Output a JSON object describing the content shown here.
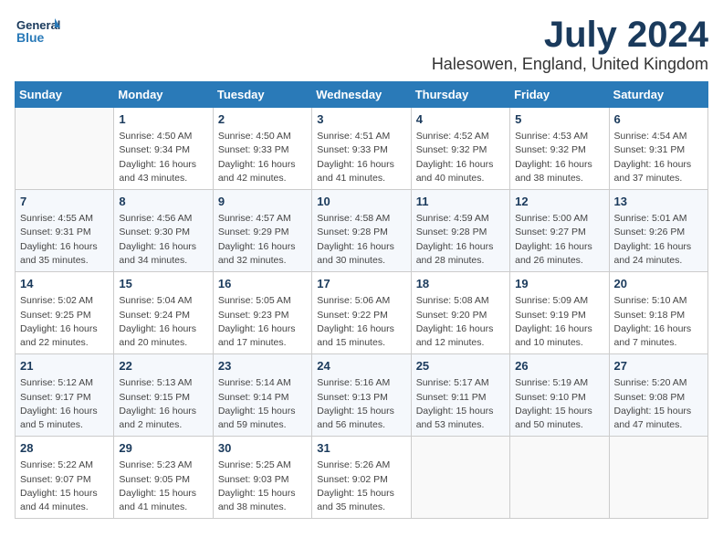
{
  "header": {
    "logo_line1": "General",
    "logo_line2": "Blue",
    "main_title": "July 2024",
    "subtitle": "Halesowen, England, United Kingdom"
  },
  "calendar": {
    "columns": [
      "Sunday",
      "Monday",
      "Tuesday",
      "Wednesday",
      "Thursday",
      "Friday",
      "Saturday"
    ],
    "weeks": [
      [
        {
          "day": "",
          "content": ""
        },
        {
          "day": "1",
          "content": "Sunrise: 4:50 AM\nSunset: 9:34 PM\nDaylight: 16 hours\nand 43 minutes."
        },
        {
          "day": "2",
          "content": "Sunrise: 4:50 AM\nSunset: 9:33 PM\nDaylight: 16 hours\nand 42 minutes."
        },
        {
          "day": "3",
          "content": "Sunrise: 4:51 AM\nSunset: 9:33 PM\nDaylight: 16 hours\nand 41 minutes."
        },
        {
          "day": "4",
          "content": "Sunrise: 4:52 AM\nSunset: 9:32 PM\nDaylight: 16 hours\nand 40 minutes."
        },
        {
          "day": "5",
          "content": "Sunrise: 4:53 AM\nSunset: 9:32 PM\nDaylight: 16 hours\nand 38 minutes."
        },
        {
          "day": "6",
          "content": "Sunrise: 4:54 AM\nSunset: 9:31 PM\nDaylight: 16 hours\nand 37 minutes."
        }
      ],
      [
        {
          "day": "7",
          "content": "Sunrise: 4:55 AM\nSunset: 9:31 PM\nDaylight: 16 hours\nand 35 minutes."
        },
        {
          "day": "8",
          "content": "Sunrise: 4:56 AM\nSunset: 9:30 PM\nDaylight: 16 hours\nand 34 minutes."
        },
        {
          "day": "9",
          "content": "Sunrise: 4:57 AM\nSunset: 9:29 PM\nDaylight: 16 hours\nand 32 minutes."
        },
        {
          "day": "10",
          "content": "Sunrise: 4:58 AM\nSunset: 9:28 PM\nDaylight: 16 hours\nand 30 minutes."
        },
        {
          "day": "11",
          "content": "Sunrise: 4:59 AM\nSunset: 9:28 PM\nDaylight: 16 hours\nand 28 minutes."
        },
        {
          "day": "12",
          "content": "Sunrise: 5:00 AM\nSunset: 9:27 PM\nDaylight: 16 hours\nand 26 minutes."
        },
        {
          "day": "13",
          "content": "Sunrise: 5:01 AM\nSunset: 9:26 PM\nDaylight: 16 hours\nand 24 minutes."
        }
      ],
      [
        {
          "day": "14",
          "content": "Sunrise: 5:02 AM\nSunset: 9:25 PM\nDaylight: 16 hours\nand 22 minutes."
        },
        {
          "day": "15",
          "content": "Sunrise: 5:04 AM\nSunset: 9:24 PM\nDaylight: 16 hours\nand 20 minutes."
        },
        {
          "day": "16",
          "content": "Sunrise: 5:05 AM\nSunset: 9:23 PM\nDaylight: 16 hours\nand 17 minutes."
        },
        {
          "day": "17",
          "content": "Sunrise: 5:06 AM\nSunset: 9:22 PM\nDaylight: 16 hours\nand 15 minutes."
        },
        {
          "day": "18",
          "content": "Sunrise: 5:08 AM\nSunset: 9:20 PM\nDaylight: 16 hours\nand 12 minutes."
        },
        {
          "day": "19",
          "content": "Sunrise: 5:09 AM\nSunset: 9:19 PM\nDaylight: 16 hours\nand 10 minutes."
        },
        {
          "day": "20",
          "content": "Sunrise: 5:10 AM\nSunset: 9:18 PM\nDaylight: 16 hours\nand 7 minutes."
        }
      ],
      [
        {
          "day": "21",
          "content": "Sunrise: 5:12 AM\nSunset: 9:17 PM\nDaylight: 16 hours\nand 5 minutes."
        },
        {
          "day": "22",
          "content": "Sunrise: 5:13 AM\nSunset: 9:15 PM\nDaylight: 16 hours\nand 2 minutes."
        },
        {
          "day": "23",
          "content": "Sunrise: 5:14 AM\nSunset: 9:14 PM\nDaylight: 15 hours\nand 59 minutes."
        },
        {
          "day": "24",
          "content": "Sunrise: 5:16 AM\nSunset: 9:13 PM\nDaylight: 15 hours\nand 56 minutes."
        },
        {
          "day": "25",
          "content": "Sunrise: 5:17 AM\nSunset: 9:11 PM\nDaylight: 15 hours\nand 53 minutes."
        },
        {
          "day": "26",
          "content": "Sunrise: 5:19 AM\nSunset: 9:10 PM\nDaylight: 15 hours\nand 50 minutes."
        },
        {
          "day": "27",
          "content": "Sunrise: 5:20 AM\nSunset: 9:08 PM\nDaylight: 15 hours\nand 47 minutes."
        }
      ],
      [
        {
          "day": "28",
          "content": "Sunrise: 5:22 AM\nSunset: 9:07 PM\nDaylight: 15 hours\nand 44 minutes."
        },
        {
          "day": "29",
          "content": "Sunrise: 5:23 AM\nSunset: 9:05 PM\nDaylight: 15 hours\nand 41 minutes."
        },
        {
          "day": "30",
          "content": "Sunrise: 5:25 AM\nSunset: 9:03 PM\nDaylight: 15 hours\nand 38 minutes."
        },
        {
          "day": "31",
          "content": "Sunrise: 5:26 AM\nSunset: 9:02 PM\nDaylight: 15 hours\nand 35 minutes."
        },
        {
          "day": "",
          "content": ""
        },
        {
          "day": "",
          "content": ""
        },
        {
          "day": "",
          "content": ""
        }
      ]
    ]
  }
}
